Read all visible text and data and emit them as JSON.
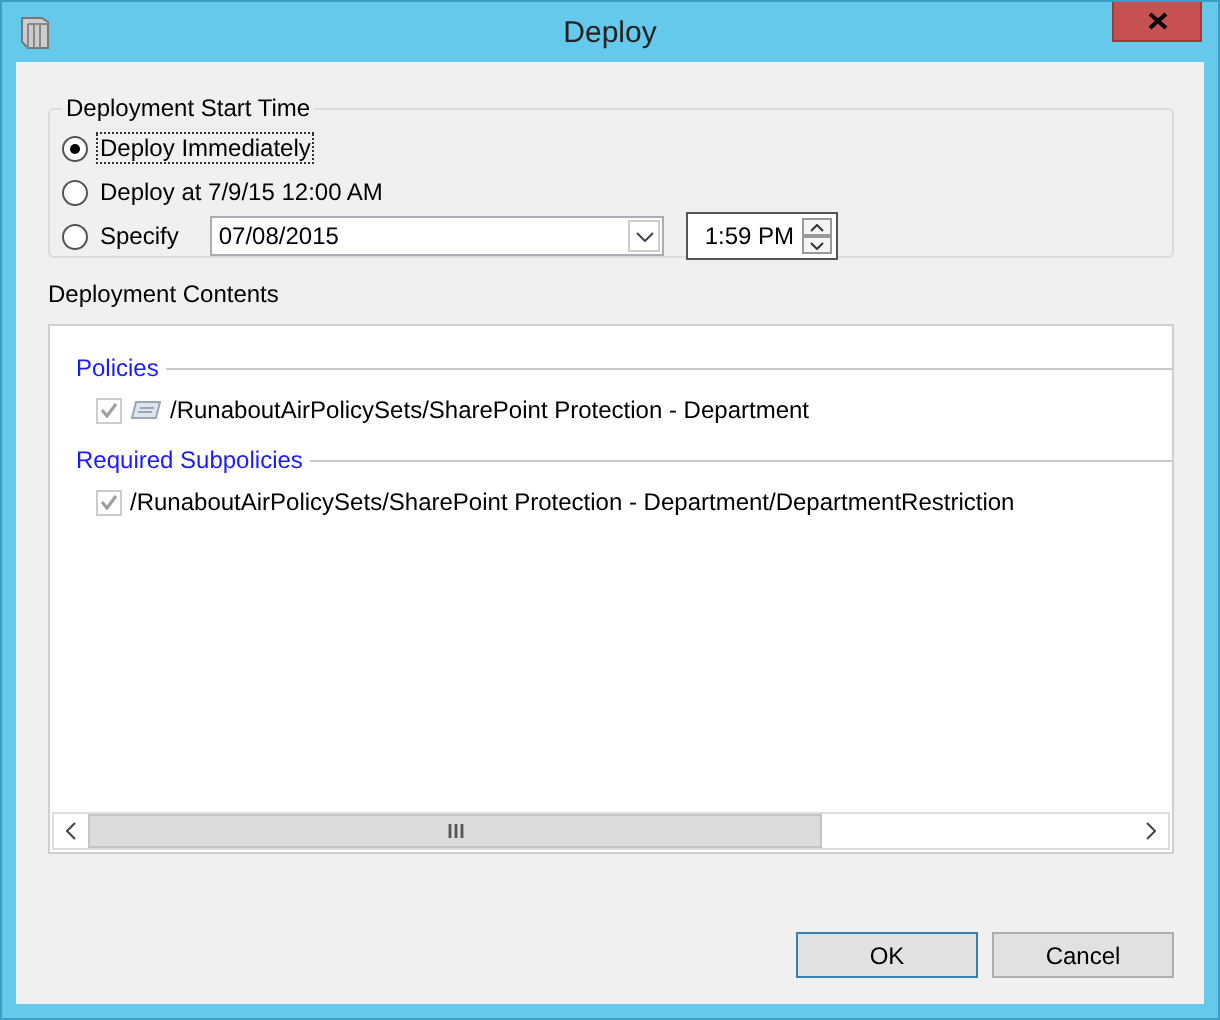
{
  "window": {
    "title": "Deploy"
  },
  "start_time": {
    "title": "Deployment Start Time",
    "options": [
      {
        "kind": "plain",
        "label": "Deploy Immediately",
        "selected": true,
        "focused": true
      },
      {
        "kind": "plain",
        "label": "Deploy at 7/9/15 12:00 AM",
        "selected": false,
        "focused": false
      },
      {
        "kind": "specify",
        "label": "Specify",
        "selected": false,
        "focused": false,
        "date": "07/08/2015",
        "time": "1:59 PM"
      }
    ]
  },
  "contents": {
    "title": "Deployment Contents",
    "sections": [
      {
        "heading": "Policies",
        "items": [
          {
            "kind": "policy",
            "text": "/RunaboutAirPolicySets/SharePoint Protection - Department",
            "checked": true,
            "disabled": true
          }
        ]
      },
      {
        "heading": "Required Subpolicies",
        "items": [
          {
            "kind": "subpolicy",
            "text": "/RunaboutAirPolicySets/SharePoint Protection - Department/DepartmentRestriction",
            "checked": true,
            "disabled": true
          }
        ]
      }
    ]
  },
  "buttons": [
    {
      "label": "OK",
      "default": true
    },
    {
      "label": "Cancel",
      "default": false
    }
  ]
}
